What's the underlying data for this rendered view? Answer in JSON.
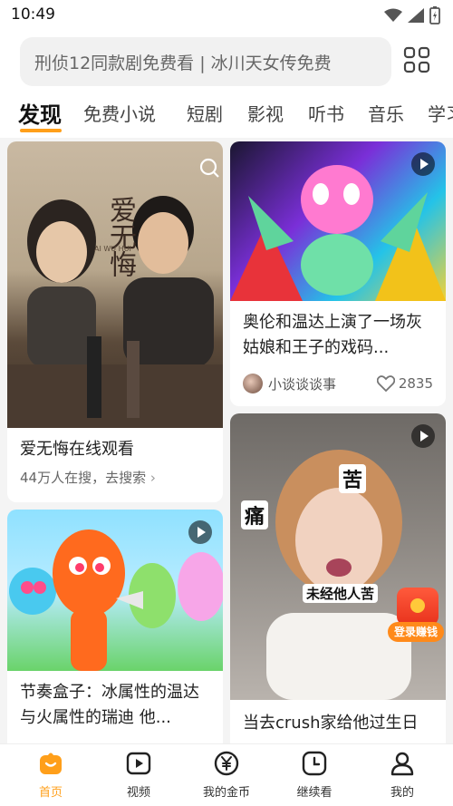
{
  "status_bar": {
    "time": "10:49"
  },
  "search": {
    "text": "刑侦12同款剧免费看 | 冰川天女传免费"
  },
  "tabs": [
    {
      "label": "发现"
    },
    {
      "label": "免费小说"
    },
    {
      "label": "短剧"
    },
    {
      "label": "影视"
    },
    {
      "label": "听书"
    },
    {
      "label": "音乐"
    },
    {
      "label": "学习"
    }
  ],
  "cards": {
    "drama": {
      "poster_title": "爱无悔",
      "poster_sub": "AI WU HUI",
      "title": "爱无悔在线观看",
      "subtitle": "44万人在搜，去搜索"
    },
    "video1": {
      "title": "奥伦和温达上演了一场灰姑娘和王子的戏码...",
      "author": "小谈谈谈事",
      "likes": "2835"
    },
    "video2": {
      "title": "节奏盒子：冰属性的温达与火属性的瑞迪 他..."
    },
    "video3": {
      "title": "当去crush家给他过生日",
      "caption_1": "痛",
      "caption_2": "苦",
      "caption_3": "未经他人苦"
    }
  },
  "floating_badge": {
    "label": "登录赚钱"
  },
  "bottom_nav": [
    {
      "label": "首页"
    },
    {
      "label": "视频"
    },
    {
      "label": "我的金币"
    },
    {
      "label": "继续看"
    },
    {
      "label": "我的"
    }
  ],
  "colors": {
    "accent": "#ff9f1a",
    "background": "#f4f4f4"
  }
}
